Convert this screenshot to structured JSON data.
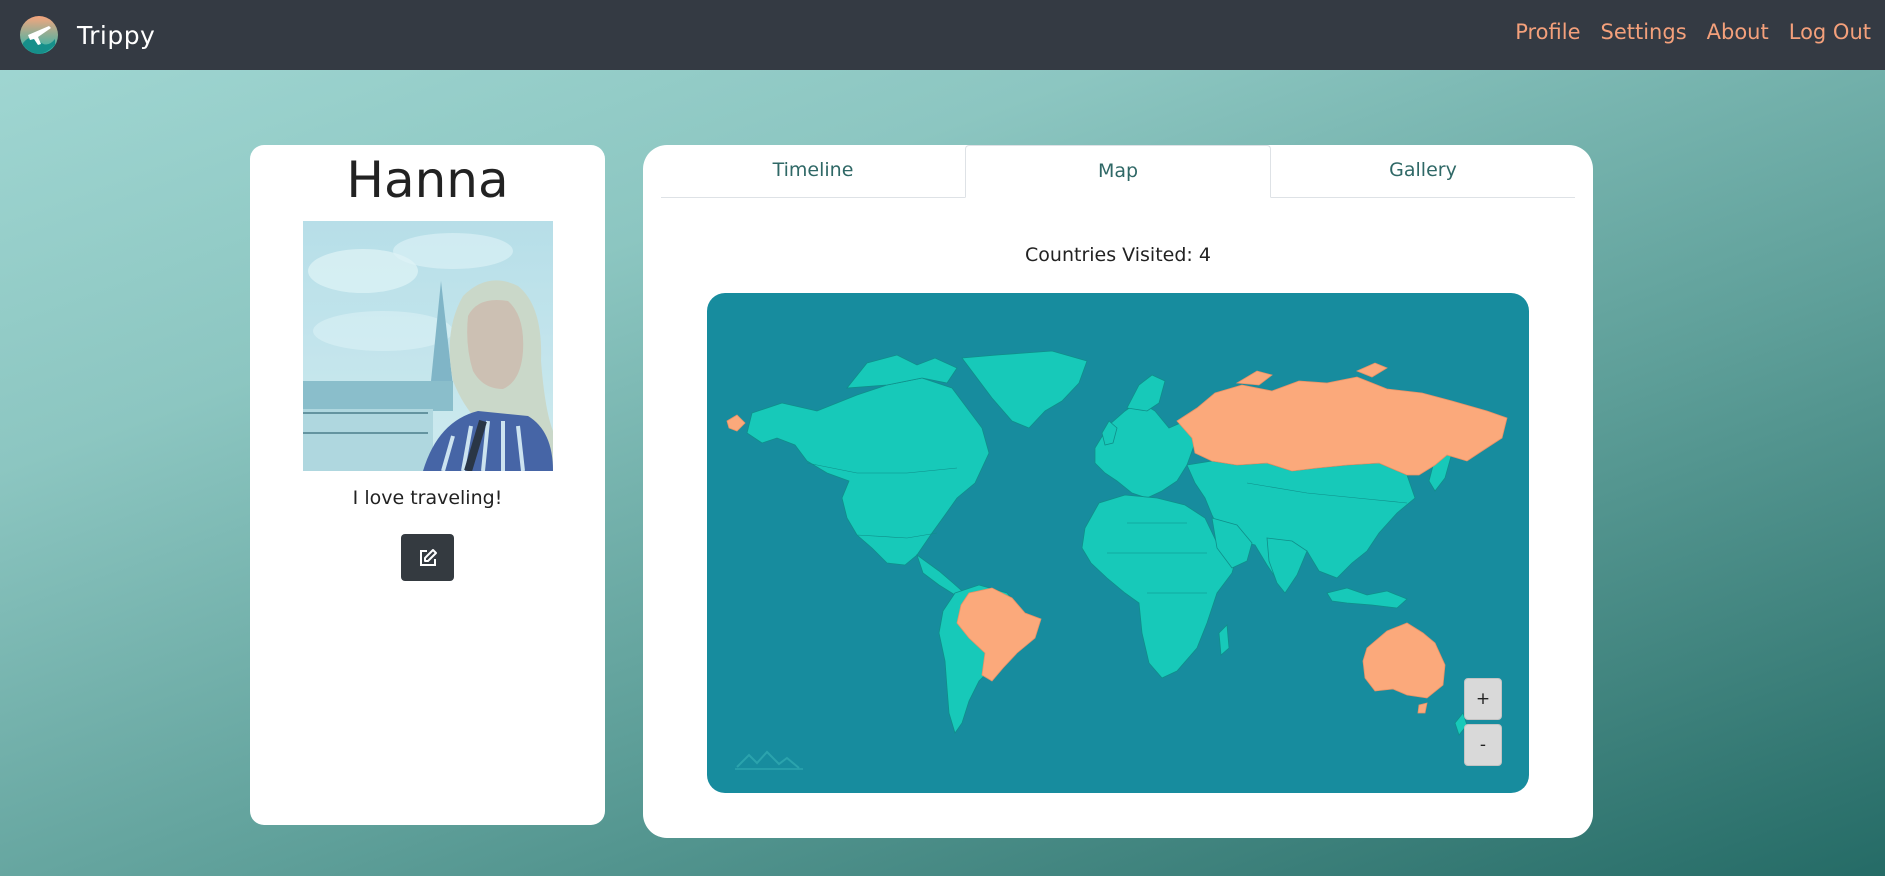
{
  "app": {
    "name": "Trippy",
    "logo_icon": "plane-globe-logo"
  },
  "nav": {
    "links": [
      "Profile",
      "Settings",
      "About",
      "Log Out"
    ],
    "link_color": "#f4a07b"
  },
  "profile": {
    "name": "Hanna",
    "bio": "I love traveling!",
    "photo_icon": "profile-photo",
    "edit_icon": "edit-icon"
  },
  "tabs": [
    {
      "label": "Timeline",
      "active": false
    },
    {
      "label": "Map",
      "active": true
    },
    {
      "label": "Gallery",
      "active": false
    }
  ],
  "map": {
    "visited_text": "Countries Visited: 4",
    "visited_countries": [
      "Russia",
      "Brazil",
      "Australia",
      "Greenland-adjacent Alaska tip"
    ],
    "colors": {
      "ocean": "#178c9e",
      "land": "#17c9b9",
      "visited": "#fba97b"
    },
    "zoom_in_label": "+",
    "zoom_out_label": "-"
  }
}
